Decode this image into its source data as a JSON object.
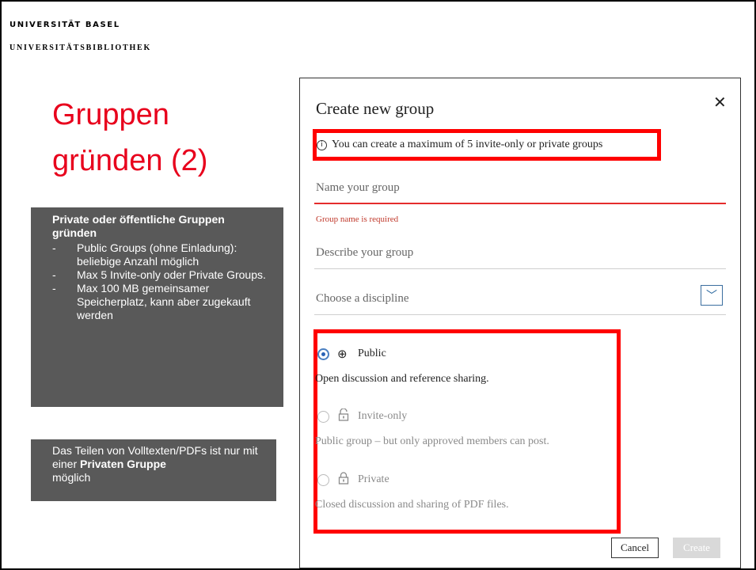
{
  "header": {
    "university": "UNIVERSITÄT BASEL",
    "library": "UNIVERSITÄTSBIBLIOTHEK"
  },
  "slide": {
    "title_line1": "Gruppen",
    "title_line2": "gründen (2)",
    "title_color": "#e8001c",
    "box1": {
      "heading_line1": "Private oder öffentliche Gruppen",
      "heading_line2": "gründen",
      "bullets": [
        "Public Groups (ohne Einladung): beliebige Anzahl möglich",
        "Max 5 Invite-only oder Private Groups.",
        "Max 100 MB gemeinsamer Speicherplatz, kann aber zugekauft werden"
      ]
    },
    "box2": {
      "text_before": "Das Teilen von Volltexten/PDFs ist nur mit einer ",
      "text_bold": "Privaten Gruppe",
      "text_after": "möglich"
    }
  },
  "dialog": {
    "title": "Create new group",
    "info": "You can create a maximum of 5 invite-only or private groups",
    "name_placeholder": "Name your group",
    "name_error": "Group name is required",
    "description_placeholder": "Describe your group",
    "discipline_placeholder": "Choose a discipline",
    "options": [
      {
        "label": "Public",
        "description": "Open discussion and reference sharing.",
        "selected": true,
        "icon": "globe-icon"
      },
      {
        "label": "Invite-only",
        "description": "Public group – but only approved members can post.",
        "selected": false,
        "icon": "lock-open-icon"
      },
      {
        "label": "Private",
        "description": "Closed discussion and sharing of PDF files.",
        "selected": false,
        "icon": "lock-icon"
      }
    ],
    "cancel_label": "Cancel",
    "create_label": "Create",
    "highlight_color": "#ff0000"
  }
}
